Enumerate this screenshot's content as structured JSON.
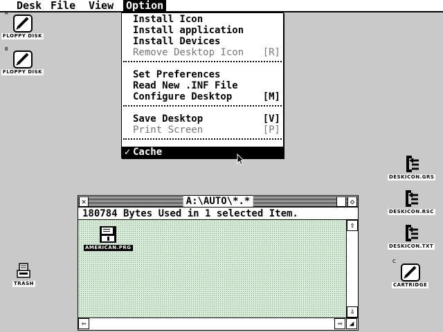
{
  "menubar": {
    "items": [
      {
        "label": "Desk"
      },
      {
        "label": "File"
      },
      {
        "label": "View"
      },
      {
        "label": "Option"
      }
    ]
  },
  "dropdown": {
    "items": [
      {
        "label": "Install Icon",
        "shortcut": "",
        "enabled": true
      },
      {
        "label": "Install application",
        "shortcut": "",
        "enabled": true
      },
      {
        "label": "Install Devices",
        "shortcut": "",
        "enabled": true
      },
      {
        "label": "Remove Desktop Icon",
        "shortcut": "[R]",
        "enabled": false
      },
      {
        "label": "Set Preferences",
        "shortcut": "",
        "enabled": true
      },
      {
        "label": "Read New .INF File",
        "shortcut": "",
        "enabled": true
      },
      {
        "label": "Configure Desktop",
        "shortcut": "[M]",
        "enabled": true
      },
      {
        "label": "Save Desktop",
        "shortcut": "[V]",
        "enabled": true
      },
      {
        "label": "Print Screen",
        "shortcut": "[P]",
        "enabled": false
      },
      {
        "label": "Cache",
        "check": "✓",
        "selected": true
      }
    ]
  },
  "desktop": {
    "floppy_a": {
      "letter": "A",
      "label": "FLOPPY DISK"
    },
    "floppy_b": {
      "letter": "B",
      "label": "FLOPPY DISK"
    },
    "trash": {
      "label": "TRASH"
    },
    "deskicon_grs": {
      "label": "DESKICON.GRS"
    },
    "deskicon_rsc": {
      "label": "DESKICON.RSC"
    },
    "deskicon_txt": {
      "label": "DESKICON.TXT"
    },
    "cartridge": {
      "letter": "C",
      "label": "CARTRIDGE"
    }
  },
  "window": {
    "title": "A:\\AUTO\\*.*",
    "info": "180784 Bytes Used in 1 selected Item.",
    "files": [
      {
        "name": "AMERICAN.PRG",
        "selected": true
      }
    ]
  }
}
